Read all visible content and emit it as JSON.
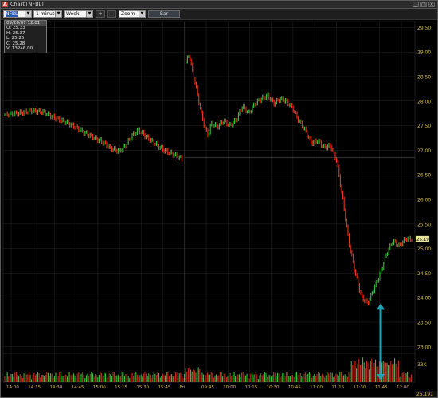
{
  "window": {
    "title": "Chart [NFBL]"
  },
  "toolbar": {
    "symbol": "NFBL",
    "interval": "1 minute",
    "range": "Week",
    "zoom_in": "+",
    "zoom_out": "-",
    "zoom": "Zoom",
    "bar": "Bar"
  },
  "infobox": {
    "header": "09/28/07 12:01",
    "open": "O: 25.33",
    "high": "H: 25.37",
    "low": "L: 25.25",
    "close": "C: 25.28",
    "volume": "V: 13246.00"
  },
  "colors": {
    "up": "#44cc44",
    "down": "#ff3b1f",
    "axis_text": "#d8b84a",
    "grid": "#262626",
    "arrow": "#1fa3b5",
    "volume": "#cc3322"
  },
  "chart_data": {
    "type": "candlestick",
    "x_tick_labels": [
      "14:00",
      "14:15",
      "14:30",
      "14:45",
      "15:00",
      "15:15",
      "15:30",
      "15:45",
      "Fri",
      "09:45",
      "10:00",
      "10:15",
      "10:30",
      "10:45",
      "11:00",
      "11:15",
      "11:30",
      "11:45",
      "12:00"
    ],
    "y_tick_labels": [
      "29.50",
      "29.00",
      "28.50",
      "28.00",
      "27.50",
      "27.00",
      "26.50",
      "26.00",
      "25.50",
      "25.00",
      "24.50",
      "24.00",
      "23.50",
      "23.00"
    ],
    "ylim": [
      22.9,
      29.62
    ],
    "last_price_label": "25.191",
    "volume_axis_label": "33K",
    "footer_price": "25.191",
    "price_path_session1": [
      [
        0,
        27.72
      ],
      [
        4,
        27.75
      ],
      [
        8,
        27.8
      ],
      [
        12,
        27.78
      ],
      [
        16,
        27.65
      ],
      [
        20,
        27.55
      ],
      [
        24,
        27.4
      ],
      [
        28,
        27.25
      ],
      [
        30,
        27.2
      ],
      [
        33,
        27.05
      ],
      [
        36,
        26.98
      ],
      [
        38,
        27.1
      ],
      [
        40,
        27.3
      ],
      [
        42,
        27.42
      ],
      [
        44,
        27.3
      ],
      [
        46,
        27.2
      ],
      [
        48,
        27.1
      ],
      [
        50,
        27.0
      ],
      [
        52,
        26.95
      ],
      [
        54,
        26.88
      ],
      [
        56,
        26.82
      ]
    ],
    "price_path_session2": [
      [
        0,
        28.8
      ],
      [
        1,
        28.95
      ],
      [
        2,
        28.6
      ],
      [
        3,
        28.35
      ],
      [
        4,
        28.0
      ],
      [
        5,
        27.7
      ],
      [
        6,
        27.45
      ],
      [
        7,
        27.3
      ],
      [
        8,
        27.55
      ],
      [
        10,
        27.48
      ],
      [
        12,
        27.6
      ],
      [
        14,
        27.5
      ],
      [
        16,
        27.62
      ],
      [
        18,
        27.9
      ],
      [
        20,
        27.75
      ],
      [
        22,
        27.95
      ],
      [
        24,
        28.05
      ],
      [
        26,
        28.12
      ],
      [
        28,
        27.95
      ],
      [
        30,
        28.05
      ],
      [
        32,
        28.0
      ],
      [
        34,
        27.85
      ],
      [
        36,
        27.6
      ],
      [
        38,
        27.4
      ],
      [
        40,
        27.15
      ],
      [
        42,
        27.2
      ],
      [
        44,
        27.05
      ],
      [
        46,
        27.1
      ],
      [
        48,
        26.8
      ],
      [
        50,
        26.0
      ],
      [
        52,
        25.1
      ],
      [
        54,
        24.5
      ],
      [
        56,
        24.0
      ],
      [
        58,
        23.88
      ],
      [
        60,
        24.2
      ],
      [
        62,
        24.5
      ],
      [
        64,
        24.9
      ],
      [
        66,
        25.15
      ],
      [
        68,
        25.05
      ],
      [
        70,
        25.2
      ],
      [
        72,
        25.19
      ]
    ],
    "annotation": "upward arrow from volume spike to session low"
  }
}
